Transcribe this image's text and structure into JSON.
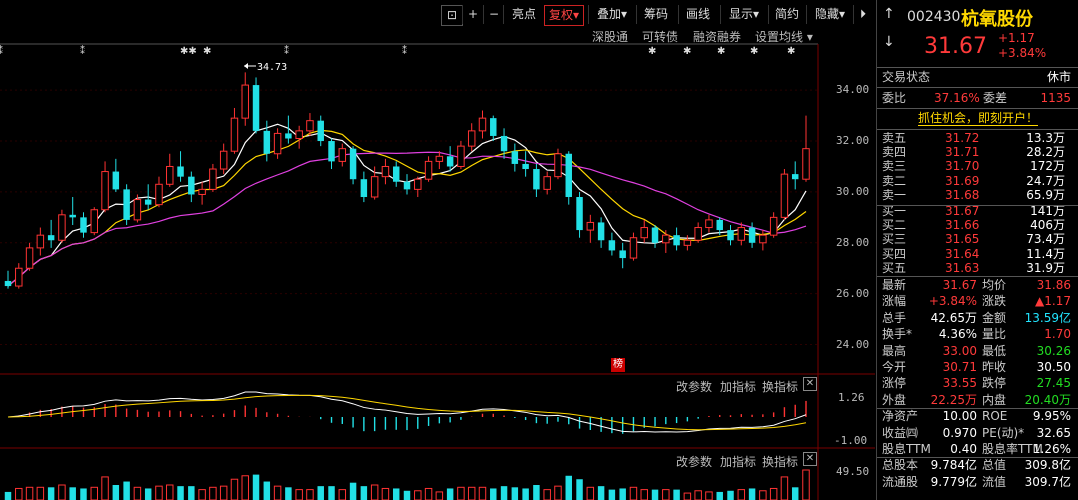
{
  "toolbar": {
    "buttons": [
      "亮点",
      "复权",
      "叠加",
      "筹码",
      "画线",
      "显示",
      "简约",
      "隐藏"
    ],
    "active_button": "复权"
  },
  "subbar": {
    "items": [
      "深股通",
      "可转债",
      "融资融券",
      "设置均线"
    ]
  },
  "chart": {
    "y_ticks": [
      "34.00",
      "32.00",
      "30.00",
      "28.00",
      "26.00",
      "24.00"
    ],
    "high_annotation": "34.73",
    "marker_text": "榜",
    "macd_axis": [
      "1.26",
      "-1.00"
    ],
    "vol_axis": [
      "49.50"
    ],
    "indicator_controls": [
      "改参数",
      "加指标",
      "换指标"
    ],
    "colors": {
      "up": "#ff3333",
      "down": "#22e0e6",
      "ma5": "#ffffff",
      "ma10": "#ffd700",
      "ma20": "#e040e0"
    }
  },
  "chart_data": {
    "type": "candlestick",
    "ylim": [
      23,
      35.5
    ],
    "candles": [
      [
        26.5,
        26.9,
        26.2,
        26.3
      ],
      [
        26.3,
        27.2,
        26.2,
        27.0
      ],
      [
        27.0,
        28.0,
        26.9,
        27.8
      ],
      [
        27.8,
        28.6,
        27.5,
        28.3
      ],
      [
        28.3,
        28.9,
        27.8,
        28.1
      ],
      [
        28.1,
        29.3,
        28.0,
        29.1
      ],
      [
        29.1,
        29.8,
        28.7,
        29.0
      ],
      [
        29.0,
        29.2,
        28.2,
        28.4
      ],
      [
        28.4,
        29.4,
        28.3,
        29.3
      ],
      [
        29.3,
        31.2,
        29.2,
        30.8
      ],
      [
        30.8,
        31.3,
        30.0,
        30.1
      ],
      [
        30.1,
        30.3,
        28.7,
        28.9
      ],
      [
        28.9,
        29.9,
        28.8,
        29.7
      ],
      [
        29.7,
        30.3,
        29.3,
        29.5
      ],
      [
        29.5,
        30.6,
        29.4,
        30.3
      ],
      [
        30.3,
        31.5,
        30.2,
        31.0
      ],
      [
        31.0,
        31.6,
        30.4,
        30.6
      ],
      [
        30.6,
        30.8,
        29.6,
        29.9
      ],
      [
        29.9,
        30.4,
        29.5,
        30.1
      ],
      [
        30.1,
        31.1,
        30.0,
        30.9
      ],
      [
        30.9,
        31.9,
        30.7,
        31.6
      ],
      [
        31.6,
        33.3,
        31.5,
        32.9
      ],
      [
        32.9,
        34.7,
        32.6,
        34.2
      ],
      [
        34.2,
        34.5,
        32.3,
        32.4
      ],
      [
        32.4,
        32.8,
        31.2,
        31.5
      ],
      [
        31.5,
        32.5,
        31.3,
        32.3
      ],
      [
        32.3,
        33.0,
        31.9,
        32.1
      ],
      [
        32.1,
        32.6,
        31.7,
        32.4
      ],
      [
        32.4,
        33.1,
        32.2,
        32.8
      ],
      [
        32.8,
        33.0,
        31.8,
        32.0
      ],
      [
        32.0,
        32.1,
        30.9,
        31.2
      ],
      [
        31.2,
        31.9,
        31.0,
        31.7
      ],
      [
        31.7,
        31.8,
        30.3,
        30.5
      ],
      [
        30.5,
        30.8,
        29.6,
        29.8
      ],
      [
        29.8,
        31.0,
        29.7,
        30.6
      ],
      [
        30.6,
        31.3,
        30.3,
        31.0
      ],
      [
        31.0,
        31.2,
        30.2,
        30.4
      ],
      [
        30.4,
        30.7,
        29.9,
        30.1
      ],
      [
        30.1,
        30.6,
        29.8,
        30.5
      ],
      [
        30.5,
        31.4,
        30.4,
        31.2
      ],
      [
        31.2,
        31.6,
        30.9,
        31.4
      ],
      [
        31.4,
        31.8,
        30.8,
        31.0
      ],
      [
        31.0,
        32.0,
        30.9,
        31.8
      ],
      [
        31.8,
        32.7,
        31.6,
        32.4
      ],
      [
        32.4,
        33.2,
        32.1,
        32.9
      ],
      [
        32.9,
        33.0,
        32.0,
        32.2
      ],
      [
        32.2,
        32.5,
        31.3,
        31.6
      ],
      [
        31.6,
        31.9,
        30.8,
        31.1
      ],
      [
        31.1,
        31.6,
        30.6,
        30.9
      ],
      [
        30.9,
        31.1,
        29.8,
        30.1
      ],
      [
        30.1,
        30.8,
        29.9,
        30.6
      ],
      [
        30.6,
        31.7,
        30.5,
        31.5
      ],
      [
        31.5,
        31.6,
        29.5,
        29.8
      ],
      [
        29.8,
        30.0,
        28.2,
        28.5
      ],
      [
        28.5,
        29.1,
        28.0,
        28.8
      ],
      [
        28.8,
        29.0,
        27.8,
        28.1
      ],
      [
        28.1,
        28.4,
        27.5,
        27.7
      ],
      [
        27.7,
        28.0,
        27.0,
        27.4
      ],
      [
        27.4,
        28.4,
        27.3,
        28.2
      ],
      [
        28.2,
        28.9,
        28.0,
        28.6
      ],
      [
        28.6,
        28.7,
        27.8,
        28.0
      ],
      [
        28.0,
        28.5,
        27.6,
        28.3
      ],
      [
        28.3,
        28.6,
        27.7,
        27.9
      ],
      [
        27.9,
        28.3,
        27.7,
        28.1
      ],
      [
        28.1,
        28.8,
        28.0,
        28.6
      ],
      [
        28.6,
        29.1,
        28.4,
        28.9
      ],
      [
        28.9,
        29.0,
        28.3,
        28.5
      ],
      [
        28.5,
        28.7,
        27.9,
        28.1
      ],
      [
        28.1,
        28.8,
        27.9,
        28.6
      ],
      [
        28.6,
        28.8,
        27.8,
        28.0
      ],
      [
        28.0,
        28.5,
        27.7,
        28.3
      ],
      [
        28.3,
        29.2,
        28.2,
        29.0
      ],
      [
        29.0,
        30.9,
        28.9,
        30.7
      ],
      [
        30.7,
        31.2,
        30.1,
        30.5
      ],
      [
        30.5,
        33.0,
        30.4,
        31.7
      ]
    ]
  },
  "panel": {
    "code": "002430",
    "name": "杭氧股份",
    "price": "31.67",
    "change": "+1.17",
    "change_pct": "+3.84%",
    "section_title": "交易状态",
    "section_status": "休市",
    "weibi_label": "委比",
    "weibi_value": "37.16%",
    "weicha_label": "委差",
    "weicha_value": "1135",
    "promo": "抓住机会，即刻开户！",
    "asks": [
      {
        "label": "卖五",
        "price": "31.72",
        "vol": "13.3万"
      },
      {
        "label": "卖四",
        "price": "31.71",
        "vol": "28.2万"
      },
      {
        "label": "卖三",
        "price": "31.70",
        "vol": "172万"
      },
      {
        "label": "卖二",
        "price": "31.69",
        "vol": "24.7万"
      },
      {
        "label": "卖一",
        "price": "31.68",
        "vol": "65.9万"
      }
    ],
    "bids": [
      {
        "label": "买一",
        "price": "31.67",
        "vol": "141万"
      },
      {
        "label": "买二",
        "price": "31.66",
        "vol": "406万"
      },
      {
        "label": "买三",
        "price": "31.65",
        "vol": "73.4万"
      },
      {
        "label": "买四",
        "price": "31.64",
        "vol": "11.4万"
      },
      {
        "label": "买五",
        "price": "31.63",
        "vol": "31.9万"
      }
    ],
    "stats": [
      {
        "l1": "最新",
        "v1": "31.67",
        "c1": "red",
        "l2": "均价",
        "v2": "31.86",
        "c2": "red"
      },
      {
        "l1": "涨幅",
        "v1": "+3.84%",
        "c1": "red",
        "l2": "涨跌",
        "v2": "▲1.17",
        "c2": "red"
      },
      {
        "l1": "总手",
        "v1": "42.65万",
        "c1": "white",
        "l2": "金额",
        "v2": "13.59亿",
        "c2": "cyan"
      },
      {
        "l1": "换手*",
        "v1": "4.36%",
        "c1": "white",
        "l2": "量比",
        "v2": "1.70",
        "c2": "red"
      },
      {
        "l1": "最高",
        "v1": "33.00",
        "c1": "red",
        "l2": "最低",
        "v2": "30.26",
        "c2": "green"
      },
      {
        "l1": "今开",
        "v1": "30.71",
        "c1": "red",
        "l2": "昨收",
        "v2": "30.50",
        "c2": "white"
      },
      {
        "l1": "涨停",
        "v1": "33.55",
        "c1": "red",
        "l2": "跌停",
        "v2": "27.45",
        "c2": "green"
      },
      {
        "l1": "外盘",
        "v1": "22.25万",
        "c1": "red",
        "l2": "内盘",
        "v2": "20.40万",
        "c2": "green"
      },
      {
        "l1": "净资产",
        "v1": "10.00",
        "c1": "white",
        "l2": "ROE",
        "v2": "9.95%",
        "c2": "white"
      },
      {
        "l1": "收益㈣",
        "v1": "0.970",
        "c1": "white",
        "l2": "PE(动)*",
        "v2": "32.65",
        "c2": "white"
      },
      {
        "l1": "股息TTM",
        "v1": "0.40",
        "c1": "white",
        "l2": "股息率TTM",
        "v2": "1.26%",
        "c2": "white"
      },
      {
        "l1": "总股本",
        "v1": "9.784亿",
        "c1": "white",
        "l2": "总值",
        "v2": "309.8亿",
        "c2": "white"
      },
      {
        "l1": "流通股",
        "v1": "9.779亿",
        "c1": "white",
        "l2": "流值",
        "v2": "309.7亿",
        "c2": "white"
      }
    ]
  }
}
